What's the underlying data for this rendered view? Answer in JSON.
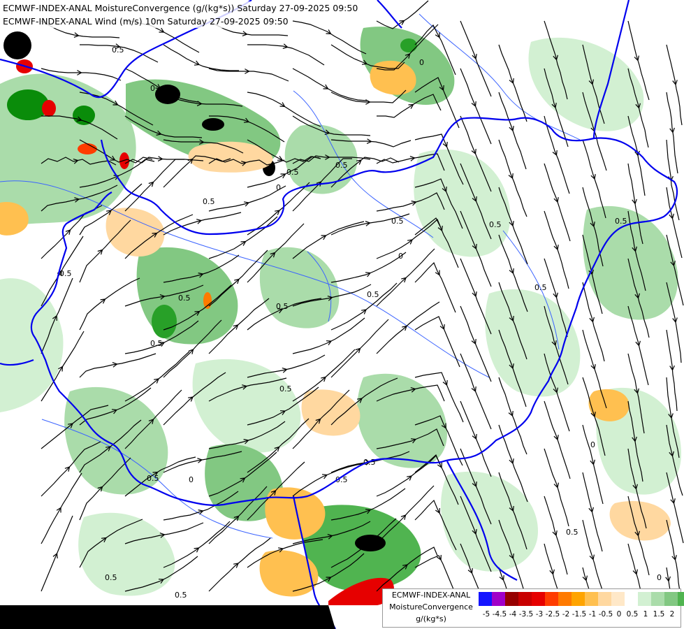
{
  "header": {
    "line1": "ECMWF-INDEX-ANAL MoistureConvergence (g/(kg*s)) Saturday 27-09-2025 09:50",
    "line2": "ECMWF-INDEX-ANAL Wind (m/s) 10m Saturday 27-09-2025 09:50"
  },
  "legend": {
    "title_line1": "ECMWF-INDEX-ANAL",
    "title_line2": "MoistureConvergence",
    "unit": "g/(kg*s)",
    "colors": [
      "#1414ff",
      "#a000c8",
      "#960000",
      "#c80000",
      "#e60000",
      "#ff3c00",
      "#ff7a00",
      "#ffa400",
      "#ffc050",
      "#ffd8a0",
      "#ffe8c8",
      "#ffffff",
      "#d2f0d2",
      "#aadcaa",
      "#82c882",
      "#50b450",
      "#28a028",
      "#0a8c0a"
    ],
    "tick_labels": [
      "-5",
      "-4.5",
      "-4",
      "-3.5",
      "-3",
      "-2.5",
      "-2",
      "-1.5",
      "-1",
      "-0.5",
      "0",
      "0.5",
      "1",
      "1.5",
      "2"
    ]
  },
  "map": {
    "contour_labels": [
      "0.5",
      "0",
      "0.5",
      "0",
      "0.5",
      "0.5",
      "0",
      "0.5",
      "0.5",
      "0",
      "0.5",
      "0.5",
      "0.5",
      "0",
      "0.5",
      "0",
      "0.5",
      "0.5",
      "0",
      "0.5",
      "0.5",
      "0.5",
      "0.5",
      "0.5",
      "0.5",
      "0.5",
      "0.5"
    ],
    "colors": {
      "border": "#0000ee",
      "river": "#3c64ff",
      "streamline": "#000000",
      "ocean": "#000000",
      "land": "#ffffff"
    }
  }
}
